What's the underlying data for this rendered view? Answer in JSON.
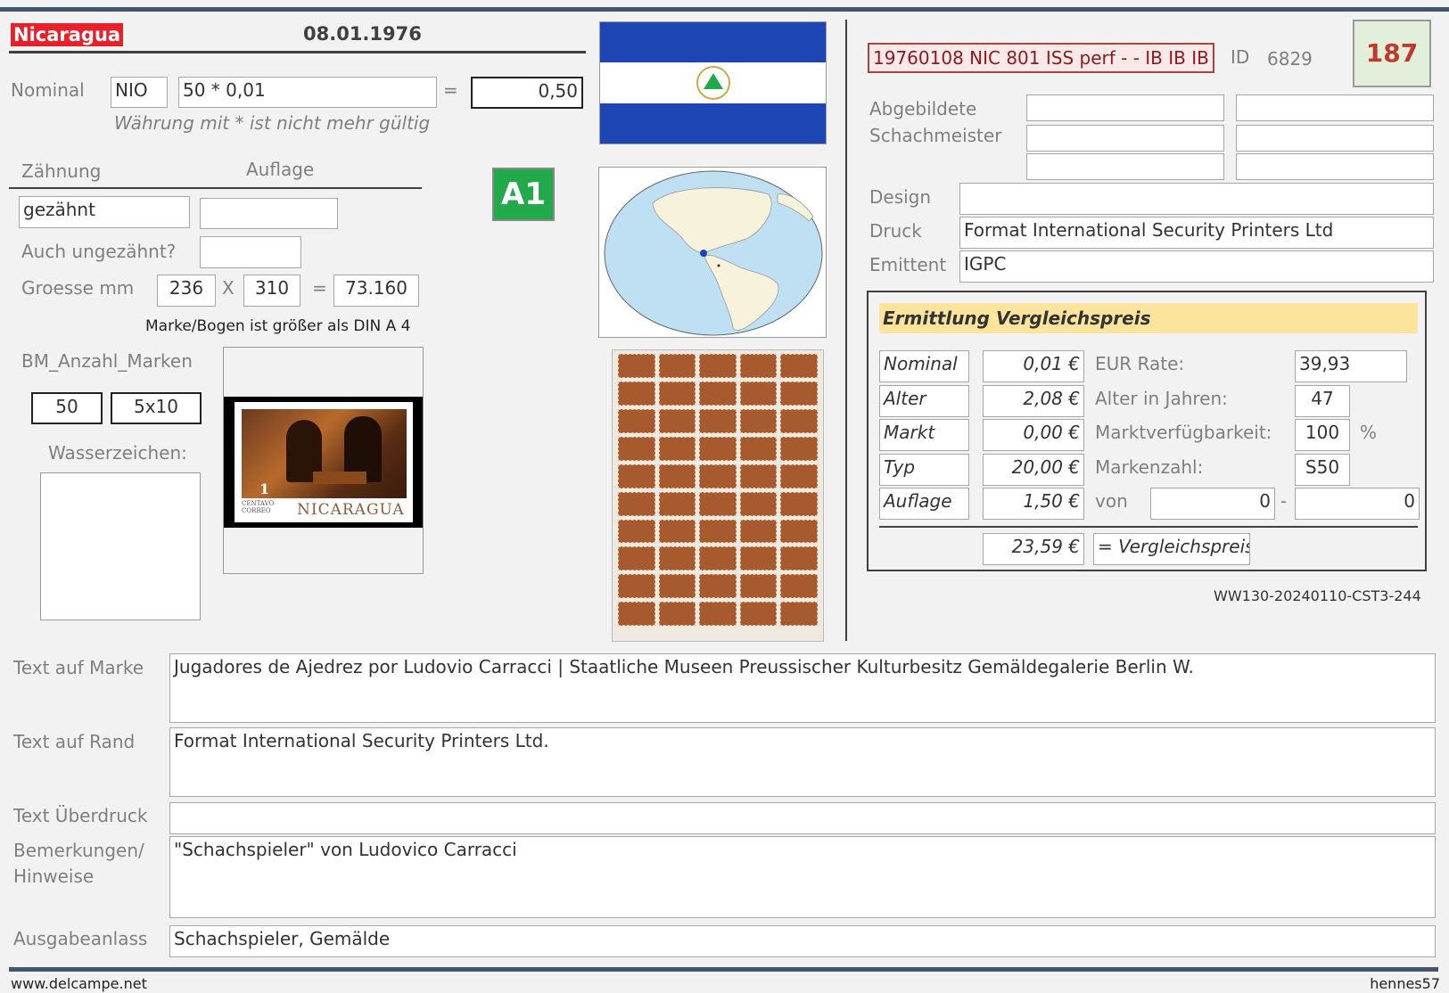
{
  "header": {
    "country": "Nicaragua",
    "date": "08.01.1976",
    "code": "19760108 NIC 801 ISS perf - - IB IB IB",
    "id_label": "ID",
    "id_value": "6829",
    "number": "187"
  },
  "nominal": {
    "label": "Nominal",
    "currency": "NIO",
    "formula": "50 * 0,01",
    "equals": "=",
    "result": "0,50",
    "note": "Währung mit * ist nicht mehr gültig"
  },
  "perforation": {
    "label_zaehnung": "Zähnung",
    "label_auflage": "Auflage",
    "zaehnung_value": "gezähnt",
    "auflage_value": "",
    "ungezaehnt_label": "Auch ungezähnt?",
    "ungezaehnt_value": ""
  },
  "size": {
    "label": "Groesse mm",
    "width": "236",
    "x": "X",
    "height": "310",
    "equals": "=",
    "area": "73.160",
    "note": "Marke/Bogen ist größer als DIN A 4"
  },
  "grade_badge": "A1",
  "bm": {
    "label": "BM_Anzahl_Marken",
    "count": "50",
    "layout": "5x10",
    "watermark_label": "Wasserzeichen:"
  },
  "stamp_image": {
    "denomination": "1",
    "country_text": "NICARAGUA",
    "small_text": "CENTAVO CORREO"
  },
  "right": {
    "abgebildete_label": "Abgebildete",
    "schachmeister_label": "Schachmeister",
    "design_label": "Design",
    "design_value": "",
    "druck_label": "Druck",
    "druck_value": "Format International Security Printers Ltd",
    "emittent_label": "Emittent",
    "emittent_value": "IGPC"
  },
  "price": {
    "title": "Ermittlung Vergleichspreis",
    "rows": [
      {
        "label": "Nominal",
        "value": "0,01 €"
      },
      {
        "label": "Alter",
        "value": "2,08 €"
      },
      {
        "label": "Markt",
        "value": "0,00 €"
      },
      {
        "label": "Typ",
        "value": "20,00 €"
      },
      {
        "label": "Auflage",
        "value": "1,50 €"
      }
    ],
    "eur_rate_label": "EUR Rate:",
    "eur_rate_value": "39,93",
    "alter_jahre_label": "Alter in Jahren:",
    "alter_jahre_value": "47",
    "markt_label": "Marktverfügbarkeit:",
    "markt_value": "100",
    "percent": "%",
    "markenzahl_label": "Markenzahl:",
    "markenzahl_value": "S50",
    "von_label": "von",
    "von_from": "0",
    "dash": "-",
    "von_to": "0",
    "total_value": "23,59 €",
    "total_label": "= Vergleichspreis"
  },
  "ref_code": "WW130-20240110-CST3-244",
  "bottom": {
    "text_marke_label": "Text auf Marke",
    "text_marke_value": "Jugadores de Ajedrez por Ludovio Carracci | Staatliche Museen Preussischer Kulturbesitz Gemäldegalerie Berlin W.",
    "text_rand_label": "Text auf Rand",
    "text_rand_value": "Format International Security Printers Ltd.",
    "ueberdruck_label": "Text Überdruck",
    "ueberdruck_value": "",
    "bemerkungen_label1": "Bemerkungen/",
    "bemerkungen_label2": "Hinweise",
    "bemerkungen_value": "\"Schachspieler\" von Ludovico Carracci",
    "anlass_label": "Ausgabeanlass",
    "anlass_value": "Schachspieler, Gemälde"
  },
  "footer": {
    "left": "www.delcampe.net",
    "right": "hennes57"
  },
  "colors": {
    "country_bg": "#e8202a",
    "badge_green": "#21a94a",
    "number_red": "#c0392b",
    "price_title_bg": "#fce49c",
    "flag_blue": "#1e45b4"
  }
}
